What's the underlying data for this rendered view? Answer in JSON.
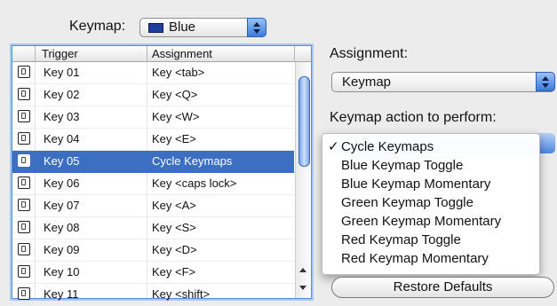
{
  "keymap": {
    "label": "Keymap:",
    "selected": "Blue",
    "swatch_color": "#1f3f9a"
  },
  "table": {
    "headers": [
      "Trigger",
      "Assignment"
    ],
    "selected_index": 4,
    "rows": [
      {
        "trigger": "Key 01",
        "assignment": "Key <tab>"
      },
      {
        "trigger": "Key 02",
        "assignment": "Key <Q>"
      },
      {
        "trigger": "Key 03",
        "assignment": "Key <W>"
      },
      {
        "trigger": "Key 04",
        "assignment": "Key <E>"
      },
      {
        "trigger": "Key 05",
        "assignment": "Cycle Keymaps"
      },
      {
        "trigger": "Key 06",
        "assignment": "Key <caps lock>"
      },
      {
        "trigger": "Key 07",
        "assignment": "Key <A>"
      },
      {
        "trigger": "Key 08",
        "assignment": "Key <S>"
      },
      {
        "trigger": "Key 09",
        "assignment": "Key <D>"
      },
      {
        "trigger": "Key 10",
        "assignment": "Key <F>"
      },
      {
        "trigger": "Key 11",
        "assignment": "Key <shift>"
      }
    ],
    "selection_color": "#3c6fc1"
  },
  "assignment": {
    "label": "Assignment:",
    "selected": "Keymap"
  },
  "action": {
    "label": "Keymap action to perform:",
    "checkmark": "✓",
    "items": [
      "Cycle Keymaps",
      "Blue Keymap Toggle",
      "Blue Keymap Momentary",
      "Green Keymap Toggle",
      "Green Keymap Momentary",
      "Red Keymap Toggle",
      "Red Keymap Momentary"
    ],
    "checked_index": 0
  },
  "restore_button": "Restore Defaults"
}
